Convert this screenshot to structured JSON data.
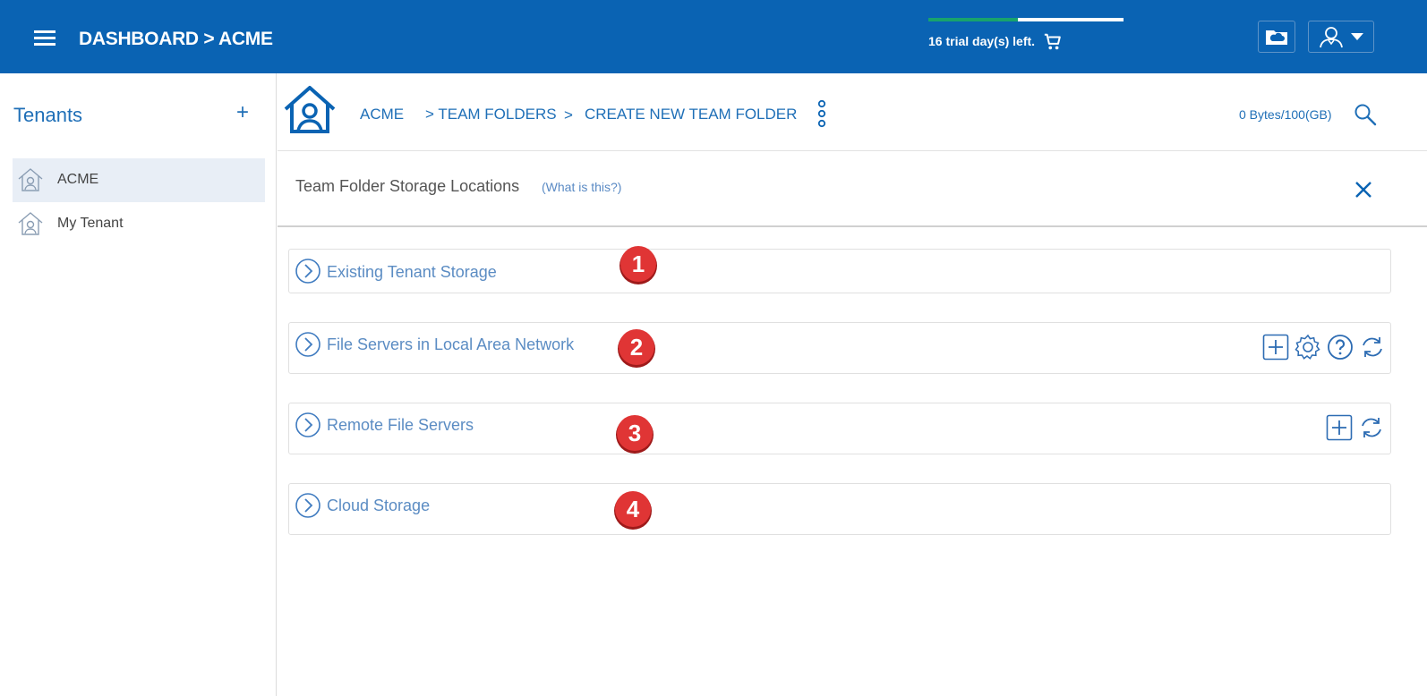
{
  "header": {
    "title": "DASHBOARD > ACME",
    "trial_text": "16 trial day(s) left.",
    "trial_progress": 0.46,
    "accent_color": "#0a63b3",
    "progress_color": "#18a36d"
  },
  "sidebar": {
    "title": "Tenants",
    "add_label": "+",
    "items": [
      {
        "label": "ACME",
        "active": true
      },
      {
        "label": "My Tenant",
        "active": false
      }
    ]
  },
  "breadcrumb": {
    "items": [
      "ACME",
      "> TEAM FOLDERS",
      ">",
      "CREATE NEW TEAM FOLDER"
    ]
  },
  "storage": {
    "usage_text": "0 Bytes/100(GB)"
  },
  "panel": {
    "title": "Team Folder Storage Locations",
    "help_link": "(What is this?)"
  },
  "sections": [
    {
      "label": "Existing Tenant Storage",
      "badge": "1",
      "actions": []
    },
    {
      "label": "File Servers in Local Area Network",
      "badge": "2",
      "actions": [
        "add-icon",
        "gear-icon",
        "help-icon",
        "refresh-icon"
      ]
    },
    {
      "label": "Remote File Servers",
      "badge": "3",
      "actions": [
        "add-icon",
        "refresh-icon"
      ]
    },
    {
      "label": "Cloud Storage",
      "badge": "4",
      "actions": []
    }
  ]
}
